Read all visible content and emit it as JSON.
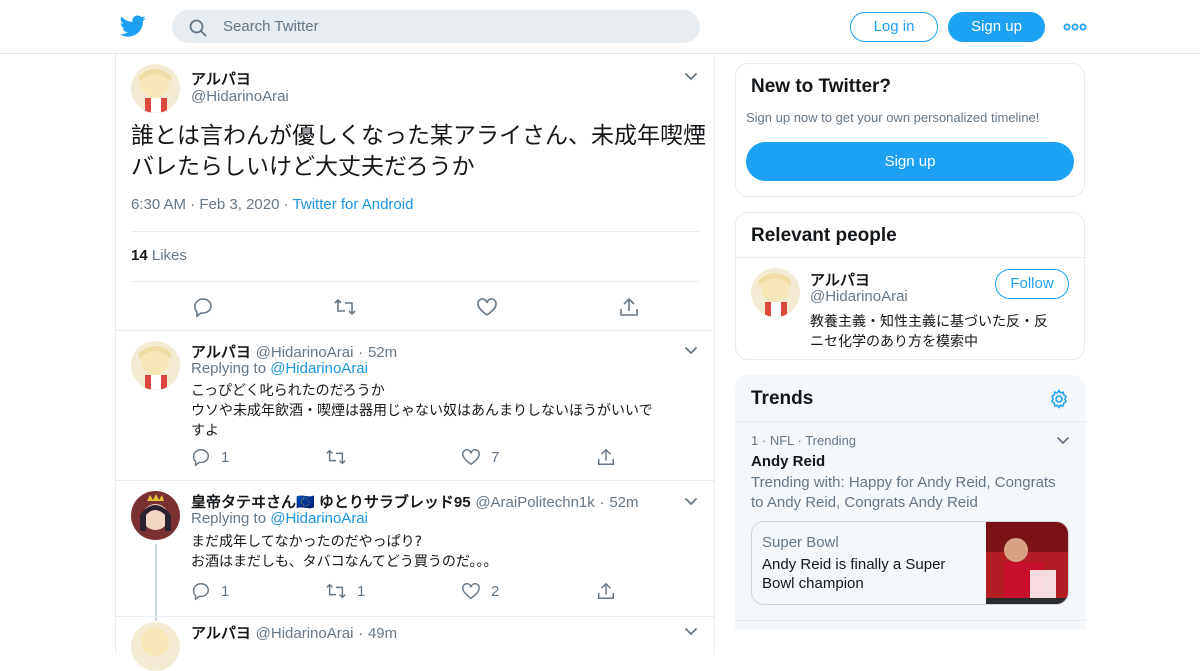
{
  "search": {
    "placeholder": "Search Twitter"
  },
  "header": {
    "login_label": "Log in",
    "signup_label": "Sign up"
  },
  "main_tweet": {
    "name": "アルパヨ",
    "handle": "@HidarinoArai",
    "text": "誰とは言わんが優しくなった某アライさん、未成年喫煙バレたらしいけど大丈夫だろうか",
    "time": "6:30 AM",
    "date": "Feb 3, 2020",
    "source": "Twitter for Android",
    "likes_count": "14",
    "likes_label": "Likes"
  },
  "replies": [
    {
      "name": "アルパヨ",
      "handle": "@HidarinoArai",
      "age": "52m",
      "replying_prefix": "Replying to",
      "replying_to": "@HidarinoArai",
      "line1": "こっぴどく叱られたのだろうか",
      "line2": "ウソや未成年飲酒・喫煙は器用じゃない奴はあんまりしないほうがいいで",
      "line3": "すよ",
      "reply_count": "1",
      "retweet_count": "",
      "like_count": "7"
    },
    {
      "name": "皇帝タテヰさん🇪🇺 ゆとりサラブレッド95",
      "handle": "@AraiPolitechn1k",
      "age": "52m",
      "replying_prefix": "Replying to",
      "replying_to": "@HidarinoArai",
      "line1": "まだ成年してなかったのだやっぱり?",
      "line2": "お酒はまだしも、タバコなんてどう買うのだ。。。",
      "reply_count": "1",
      "retweet_count": "1",
      "like_count": "2"
    },
    {
      "name": "アルパヨ",
      "handle": "@HidarinoArai",
      "age": "49m"
    }
  ],
  "new_to_twitter": {
    "title": "New to Twitter?",
    "subtitle": "Sign up now to get your own personalized timeline!",
    "signup_label": "Sign up"
  },
  "relevant_people": {
    "title": "Relevant people",
    "name": "アルパヨ",
    "handle": "@HidarinoArai",
    "follow_label": "Follow",
    "bio_line1": "教養主義・知性主義に基づいた反・反",
    "bio_line2": "ニセ化学のあり方を模索中"
  },
  "trends": {
    "title": "Trends",
    "rank": "1",
    "category": "NFL · Trending",
    "name": "Andy Reid",
    "trending_with_line1": "Trending with: Happy for Andy Reid, Congrats",
    "trending_with_line2": "to Andy Reid, Congrats Andy Reid",
    "news_source": "Super Bowl",
    "news_line1": "Andy Reid is finally a Super",
    "news_line2": "Bowl champion"
  },
  "colors": {
    "accent": "#1da1f2",
    "link": "#1b95e0",
    "muted": "#657786",
    "border": "#e6ecf0"
  },
  "icons": [
    "twitter-bird-icon",
    "search-icon",
    "more-icon",
    "chevron-down-icon",
    "reply-icon",
    "retweet-icon",
    "like-icon",
    "share-icon",
    "settings-gear-icon"
  ]
}
